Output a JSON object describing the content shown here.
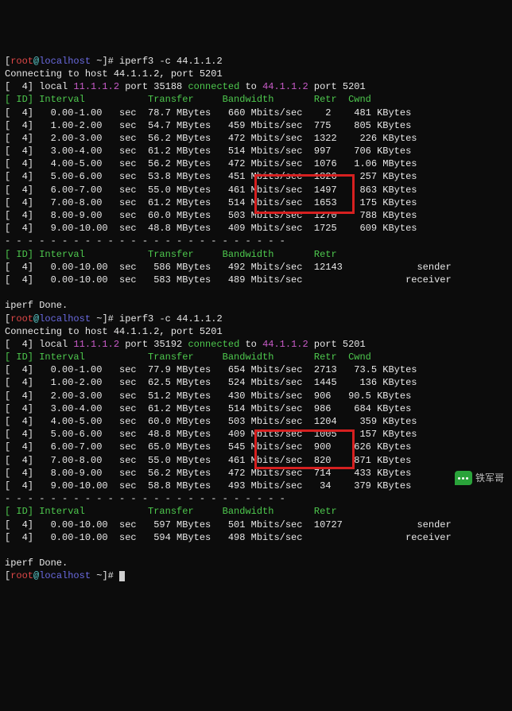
{
  "run1": {
    "prompt": {
      "user": "root",
      "at": "@",
      "host": "localhost",
      "path": " ~",
      "hash": "]# ",
      "cmd": "iperf3 -c 44.1.1.2"
    },
    "connecting": "Connecting to host 44.1.1.2, port 5201",
    "local": {
      "prefix": "[  4] local ",
      "ip1": "11.1.1.2",
      "mid": " port 35188 ",
      "conn": "connected",
      "mid2": " to ",
      "ip2": "44.1.1.2",
      "suffix": " port 5201"
    },
    "hdr": "[ ID] Interval           Transfer     Bandwidth       Retr  Cwnd",
    "rows": [
      "[  4]   0.00-1.00   sec  78.7 MBytes   660 Mbits/sec    2    481 KBytes",
      "[  4]   1.00-2.00   sec  54.7 MBytes   459 Mbits/sec  775    805 KBytes",
      "[  4]   2.00-3.00   sec  56.2 MBytes   472 Mbits/sec  1322    226 KBytes",
      "[  4]   3.00-4.00   sec  61.2 MBytes   514 Mbits/sec  997    706 KBytes",
      "[  4]   4.00-5.00   sec  56.2 MBytes   472 Mbits/sec  1076   1.06 MBytes",
      "[  4]   5.00-6.00   sec  53.8 MBytes   451 Mbits/sec  1826    257 KBytes",
      "[  4]   6.00-7.00   sec  55.0 MBytes   461 Mbits/sec  1497    863 KBytes",
      "[  4]   7.00-8.00   sec  61.2 MBytes   514 Mbits/sec  1653    175 KBytes",
      "[  4]   8.00-9.00   sec  60.0 MBytes   503 Mbits/sec  1270    788 KBytes",
      "[  4]   9.00-10.00  sec  48.8 MBytes   409 Mbits/sec  1725    609 KBytes"
    ],
    "dash": "- - - - - - - - - - - - - - - - - - - - - - - - -",
    "sumhdr": "[ ID] Interval           Transfer     Bandwidth       Retr",
    "sum1": "[  4]   0.00-10.00  sec   586 MBytes   492 Mbits/sec  12143             sender",
    "sum2": "[  4]   0.00-10.00  sec   583 MBytes   489 Mbits/sec                  receiver",
    "done": "iperf Done."
  },
  "run2": {
    "prompt": {
      "user": "root",
      "at": "@",
      "host": "localhost",
      "path": " ~",
      "hash": "]# ",
      "cmd": "iperf3 -c 44.1.1.2"
    },
    "connecting": "Connecting to host 44.1.1.2, port 5201",
    "local": {
      "prefix": "[  4] local ",
      "ip1": "11.1.1.2",
      "mid": " port 35192 ",
      "conn": "connected",
      "mid2": " to ",
      "ip2": "44.1.1.2",
      "suffix": " port 5201"
    },
    "hdr": "[ ID] Interval           Transfer     Bandwidth       Retr  Cwnd",
    "rows": [
      "[  4]   0.00-1.00   sec  77.9 MBytes   654 Mbits/sec  2713   73.5 KBytes",
      "[  4]   1.00-2.00   sec  62.5 MBytes   524 Mbits/sec  1445    136 KBytes",
      "[  4]   2.00-3.00   sec  51.2 MBytes   430 Mbits/sec  906   90.5 KBytes",
      "[  4]   3.00-4.00   sec  61.2 MBytes   514 Mbits/sec  986    684 KBytes",
      "[  4]   4.00-5.00   sec  60.0 MBytes   503 Mbits/sec  1204    359 KBytes",
      "[  4]   5.00-6.00   sec  48.8 MBytes   409 Mbits/sec  1005    157 KBytes",
      "[  4]   6.00-7.00   sec  65.0 MBytes   545 Mbits/sec  900    626 KBytes",
      "[  4]   7.00-8.00   sec  55.0 MBytes   461 Mbits/sec  820    871 KBytes",
      "[  4]   8.00-9.00   sec  56.2 MBytes   472 Mbits/sec  714    433 KBytes",
      "[  4]   9.00-10.00  sec  58.8 MBytes   493 Mbits/sec   34    379 KBytes"
    ],
    "dash": "- - - - - - - - - - - - - - - - - - - - - - - - -",
    "sumhdr": "[ ID] Interval           Transfer     Bandwidth       Retr",
    "sum1": "[  4]   0.00-10.00  sec   597 MBytes   501 Mbits/sec  10727             sender",
    "sum2": "[  4]   0.00-10.00  sec   594 MBytes   498 Mbits/sec                  receiver",
    "done": "iperf Done."
  },
  "final_prompt": {
    "user": "root",
    "at": "@",
    "host": "localhost",
    "path": " ~",
    "hash": "]# "
  },
  "watermark": "铁军哥"
}
